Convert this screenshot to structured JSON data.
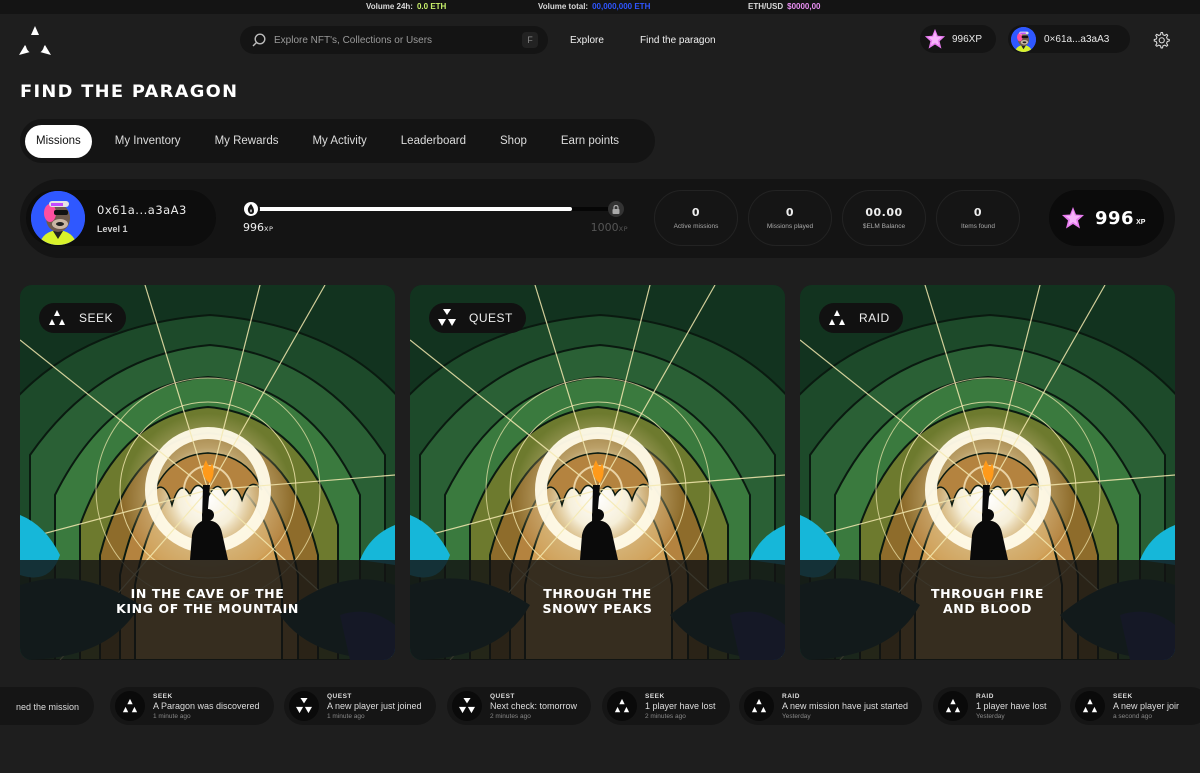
{
  "ticker": {
    "volume_24h_label": "Volume 24h:",
    "volume_24h_value": "0.0 ETH",
    "volume_total_label": "Volume total:",
    "volume_total_value": "00,000,000 ETH",
    "eth_usd_label": "ETH/USD",
    "eth_usd_value": "$0000,00"
  },
  "header": {
    "logo": "paragon-logo-icon",
    "search_placeholder": "Explore NFT's, Collections or Users",
    "search_shortcut": "F",
    "nav": [
      "Explore",
      "Find the paragon"
    ],
    "xp": "996XP",
    "account": "0×61a...a3aA3",
    "settings_icon": "gear-icon"
  },
  "page": {
    "title": "FIND THE PARAGON"
  },
  "tabs": [
    {
      "label": "Missions",
      "active": true
    },
    {
      "label": "My Inventory",
      "active": false
    },
    {
      "label": "My Rewards",
      "active": false
    },
    {
      "label": "My Activity",
      "active": false
    },
    {
      "label": "Leaderboard",
      "active": false
    },
    {
      "label": "Shop",
      "active": false
    },
    {
      "label": "Earn points",
      "active": false
    }
  ],
  "profile": {
    "address": "0x61a...a3aA3",
    "level": "Level 1"
  },
  "progress": {
    "current_xp": 996,
    "max_xp": 1000,
    "current_label": "996",
    "max_label": "1000",
    "unit": "XP"
  },
  "stats": [
    {
      "value": "0",
      "label": "Active missions"
    },
    {
      "value": "0",
      "label": "Missions played"
    },
    {
      "value": "00.00",
      "label": "$ELM Balance"
    },
    {
      "value": "0",
      "label": "Items found"
    }
  ],
  "xp_total": {
    "value": "996",
    "unit": "XP"
  },
  "missions": [
    {
      "type": "SEEK",
      "title": "IN THE CAVE OF THE\nKING OF THE MOUNTAIN"
    },
    {
      "type": "QUEST",
      "title": "THROUGH THE\nSNOWY PEAKS"
    },
    {
      "type": "RAID",
      "title": "THROUGH FIRE\nAND BLOOD"
    }
  ],
  "colors": {
    "accent_green": "#c9f26b",
    "accent_blue": "#2f56ff",
    "accent_pink": "#e98ff2",
    "xp_star": "#e87cf0"
  },
  "feed": [
    {
      "type": "",
      "message": "ned the mission",
      "time": ""
    },
    {
      "type": "SEEK",
      "message": "A Paragon was discovered",
      "time": "1 minute ago"
    },
    {
      "type": "QUEST",
      "message": "A new player just joined",
      "time": "1 minute ago"
    },
    {
      "type": "QUEST",
      "message": "Next check: tomorrow",
      "time": "2 minutes ago"
    },
    {
      "type": "SEEK",
      "message": "1 player have lost",
      "time": "2 minutes ago"
    },
    {
      "type": "RAID",
      "message": "A new mission have just started",
      "time": "Yesterday"
    },
    {
      "type": "RAID",
      "message": "1 player have lost",
      "time": "Yesterday"
    },
    {
      "type": "SEEK",
      "message": "A new player joir",
      "time": "a second ago"
    }
  ]
}
